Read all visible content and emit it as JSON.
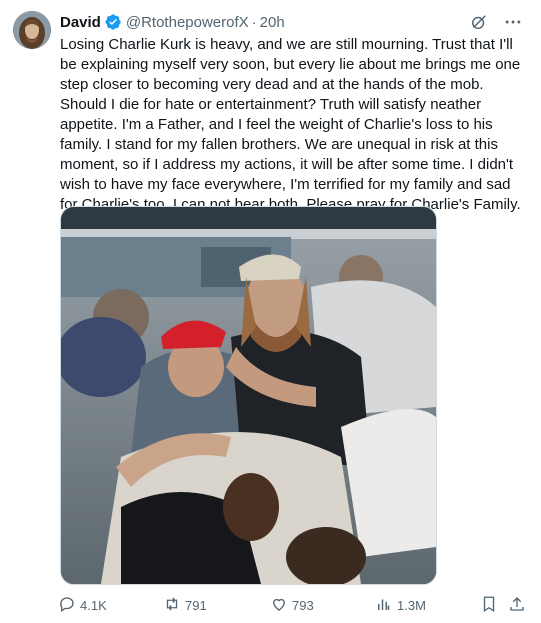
{
  "post": {
    "author_name": "David",
    "handle": "@RtothepowerofX",
    "separator": "·",
    "time": "20h",
    "text": "Losing Charlie Kurk is heavy, and we are still mourning. Trust that I'll be explaining myself very soon, but every lie about me brings me one step closer to becoming very dead and at the hands of the mob. Should I die for hate or entertainment? Truth will satisfy neather appetite. I'm a Father, and I feel the weight of Charlie's loss to his family. I stand for my fallen brothers. We are unequal in risk at this moment, so if I address my actions, it will be after some time. I didn't wish to have my face everywhere, I'm terrified for my family and sad for Charlie's too. I can not bear both. Please pray for Charlie's Family."
  },
  "actions": {
    "replies": "4.1K",
    "reposts": "791",
    "likes": "793",
    "views": "1.3M"
  },
  "icons": {
    "verified": "verified-badge-icon",
    "grok": "grok-icon",
    "more": "more-icon",
    "reply": "reply-icon",
    "repost": "repost-icon",
    "like": "like-icon",
    "views": "views-icon",
    "bookmark": "bookmark-icon",
    "share": "share-icon"
  },
  "colors": {
    "verified_blue": "#1d9bf0",
    "secondary_text": "#536471",
    "text": "#0f1419"
  }
}
